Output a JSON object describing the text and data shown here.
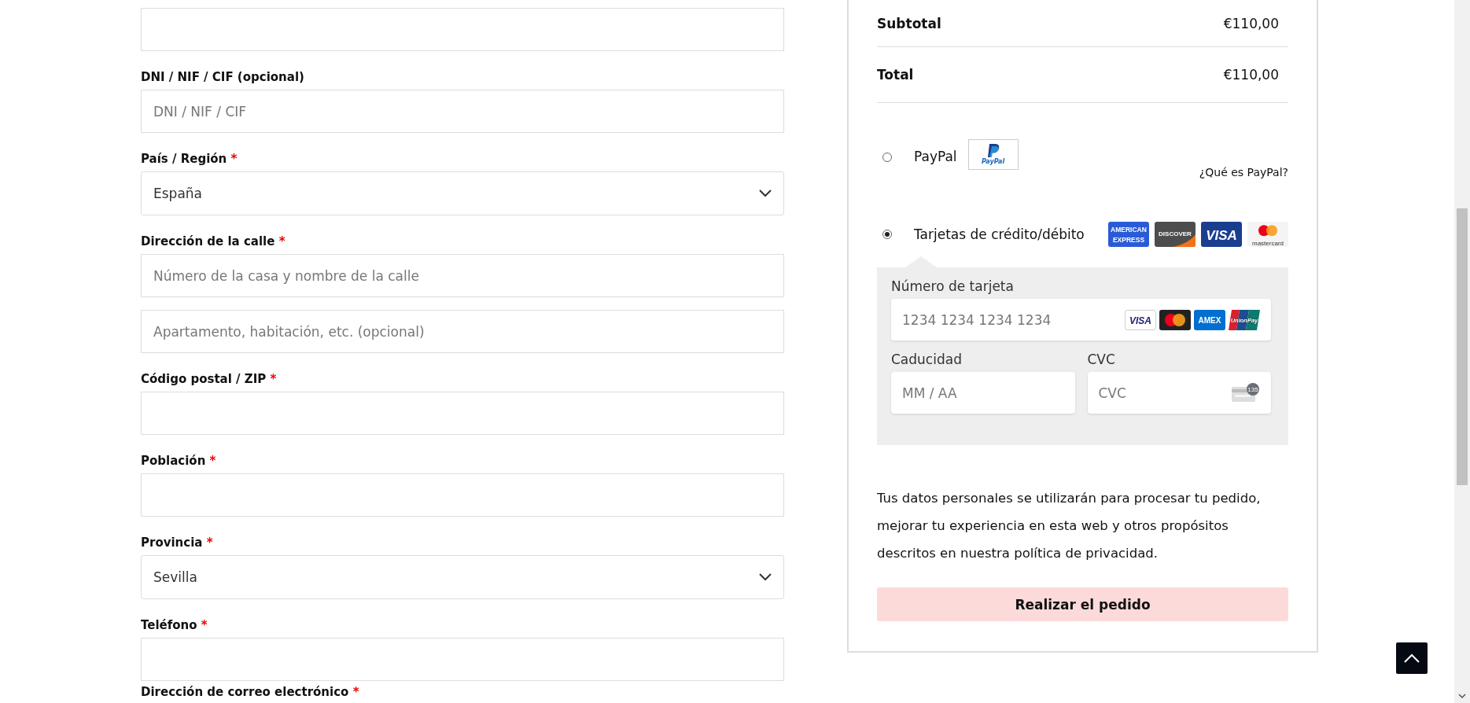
{
  "billing_form": {
    "fields": [
      {
        "kind": "text"
      },
      {
        "kind": "text",
        "label": "DNI / NIF / CIF (opcional)",
        "placeholder": "DNI / NIF / CIF"
      },
      {
        "kind": "select",
        "label": "País / Región",
        "required_mark": "*",
        "value": "España"
      },
      {
        "kind": "text",
        "label": "Dirección de la calle",
        "required_mark": "*",
        "placeholder": "Número de la casa y nombre de la calle"
      },
      {
        "kind": "text",
        "placeholder": "Apartamento, habitación, etc. (opcional)"
      },
      {
        "kind": "text",
        "label": "Código postal / ZIP",
        "required_mark": "*"
      },
      {
        "kind": "text",
        "label": "Población",
        "required_mark": "*"
      },
      {
        "kind": "select",
        "label": "Provincia",
        "required_mark": "*",
        "value": "Sevilla"
      },
      {
        "kind": "text",
        "label": "Teléfono",
        "required_mark": "*"
      },
      {
        "kind": "label",
        "label": "Dirección de correo electrónico",
        "required_mark": "*"
      }
    ]
  },
  "order_summary": {
    "rows": [
      {
        "label": "Subtotal",
        "amount": "€110,00"
      },
      {
        "label": "Total",
        "amount": "€110,00"
      }
    ]
  },
  "payment_methods": [
    {
      "kind": "paypal",
      "label": "PayPal",
      "selected": false,
      "logo_text": "PayPal",
      "link": "¿Qué es PayPal?"
    },
    {
      "kind": "cards",
      "label": "Tarjetas de crédito/débito",
      "selected": true,
      "brands": [
        {
          "kind": "amex",
          "text": "AMERICAN EXPRESS"
        },
        {
          "kind": "discover",
          "text": "DISCOVER"
        },
        {
          "kind": "visa",
          "text": "VISA"
        },
        {
          "kind": "mastercard",
          "text": "mastercard"
        }
      ]
    }
  ],
  "card_form": {
    "number": {
      "label": "Número de tarjeta",
      "placeholder": "1234 1234 1234 1234",
      "brands": [
        {
          "kind": "visa",
          "text": "VISA"
        },
        {
          "kind": "mastercard"
        },
        {
          "kind": "amex",
          "text": "AMEX"
        },
        {
          "kind": "unionpay",
          "text": "UnionPay"
        }
      ]
    },
    "expiry": {
      "label": "Caducidad",
      "placeholder": "MM / AA"
    },
    "cvc": {
      "label": "CVC",
      "placeholder": "CVC",
      "hint": "135"
    }
  },
  "privacy_text": "Tus datos personales se utilizarán para procesar tu pedido, mejorar tu experiencia en esta web y otros propósitos descritos en nuestra política de privacidad.",
  "place_order_button": "Realizar el pedido"
}
